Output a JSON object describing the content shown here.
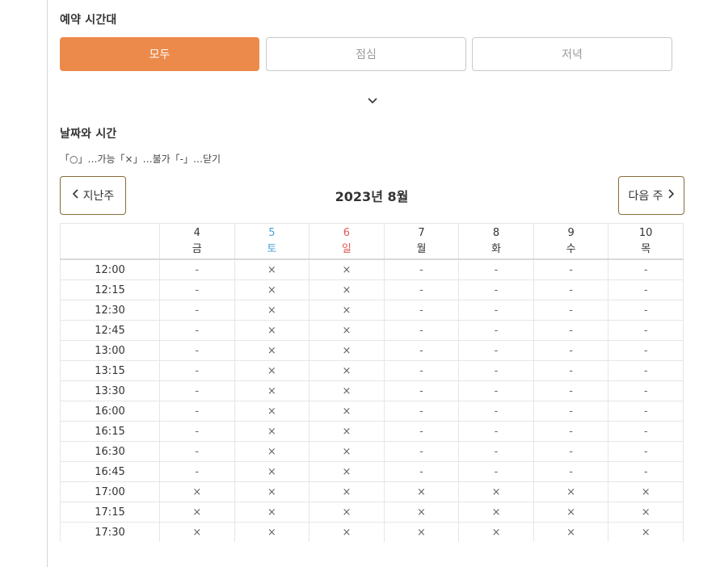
{
  "time_section": {
    "title": "예약 시간대",
    "options": [
      {
        "label": "모두",
        "selected": true
      },
      {
        "label": "점심",
        "selected": false
      },
      {
        "label": "저녁",
        "selected": false
      }
    ],
    "expand_icon": "chevron-down-icon"
  },
  "date_section": {
    "title": "날짜와 시간",
    "legend": "「○」…가능「×」…불가「-」…닫기",
    "prev_label": "지난주",
    "next_label": "다음 주",
    "month_label": "2023년 8월"
  },
  "colors": {
    "accent": "#ec8a4c",
    "saturday": "#4aa3d6",
    "sunday": "#e0585a"
  },
  "schedule": {
    "days": [
      {
        "date": "4",
        "weekday": "금",
        "type": "weekday"
      },
      {
        "date": "5",
        "weekday": "토",
        "type": "saturday"
      },
      {
        "date": "6",
        "weekday": "일",
        "type": "sunday"
      },
      {
        "date": "7",
        "weekday": "월",
        "type": "weekday"
      },
      {
        "date": "8",
        "weekday": "화",
        "type": "weekday"
      },
      {
        "date": "9",
        "weekday": "수",
        "type": "weekday"
      },
      {
        "date": "10",
        "weekday": "목",
        "type": "weekday"
      }
    ],
    "rows": [
      {
        "time": "12:00",
        "cells": [
          "-",
          "×",
          "×",
          "-",
          "-",
          "-",
          "-"
        ]
      },
      {
        "time": "12:15",
        "cells": [
          "-",
          "×",
          "×",
          "-",
          "-",
          "-",
          "-"
        ]
      },
      {
        "time": "12:30",
        "cells": [
          "-",
          "×",
          "×",
          "-",
          "-",
          "-",
          "-"
        ]
      },
      {
        "time": "12:45",
        "cells": [
          "-",
          "×",
          "×",
          "-",
          "-",
          "-",
          "-"
        ]
      },
      {
        "time": "13:00",
        "cells": [
          "-",
          "×",
          "×",
          "-",
          "-",
          "-",
          "-"
        ]
      },
      {
        "time": "13:15",
        "cells": [
          "-",
          "×",
          "×",
          "-",
          "-",
          "-",
          "-"
        ]
      },
      {
        "time": "13:30",
        "cells": [
          "-",
          "×",
          "×",
          "-",
          "-",
          "-",
          "-"
        ]
      },
      {
        "time": "16:00",
        "cells": [
          "-",
          "×",
          "×",
          "-",
          "-",
          "-",
          "-"
        ]
      },
      {
        "time": "16:15",
        "cells": [
          "-",
          "×",
          "×",
          "-",
          "-",
          "-",
          "-"
        ]
      },
      {
        "time": "16:30",
        "cells": [
          "-",
          "×",
          "×",
          "-",
          "-",
          "-",
          "-"
        ]
      },
      {
        "time": "16:45",
        "cells": [
          "-",
          "×",
          "×",
          "-",
          "-",
          "-",
          "-"
        ]
      },
      {
        "time": "17:00",
        "cells": [
          "×",
          "×",
          "×",
          "×",
          "×",
          "×",
          "×"
        ]
      },
      {
        "time": "17:15",
        "cells": [
          "×",
          "×",
          "×",
          "×",
          "×",
          "×",
          "×"
        ]
      },
      {
        "time": "17:30",
        "cells": [
          "×",
          "×",
          "×",
          "×",
          "×",
          "×",
          "×"
        ]
      }
    ]
  }
}
